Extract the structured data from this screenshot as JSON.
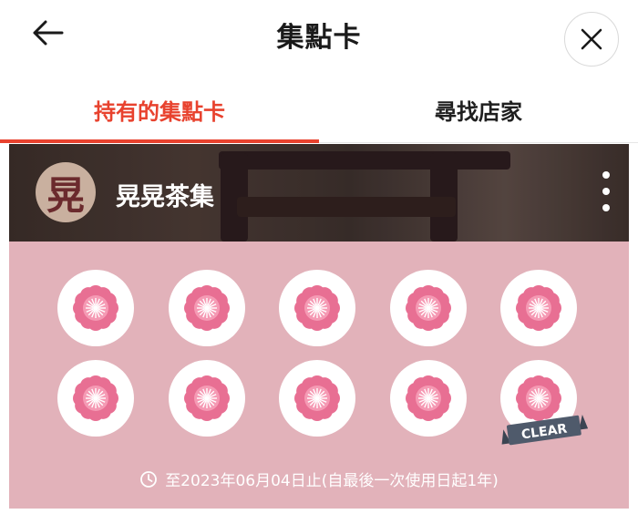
{
  "header": {
    "back_icon": "arrow-left-icon",
    "title": "集點卡",
    "close_icon": "close-icon"
  },
  "tabs": [
    {
      "label": "持有的集點卡",
      "active": true
    },
    {
      "label": "尋找店家",
      "active": false
    }
  ],
  "card": {
    "avatar_text": "晃",
    "shop_name": "晃晃茶集",
    "menu_icon": "more-vertical-icon",
    "stamps_collected": 10,
    "stamps_total": 10,
    "stamp_icon": "flower-stamp-icon",
    "badge_text": "CLEAR",
    "expiry_icon": "clock-icon",
    "expiry_text": "至2023年06月04日止(自最後一次使用日起1年)"
  },
  "colors": {
    "accent": "#e8422e",
    "card_bg": "#e2b2ba",
    "stamp_flower": "#e86f93",
    "badge": "#4f5a6b"
  }
}
